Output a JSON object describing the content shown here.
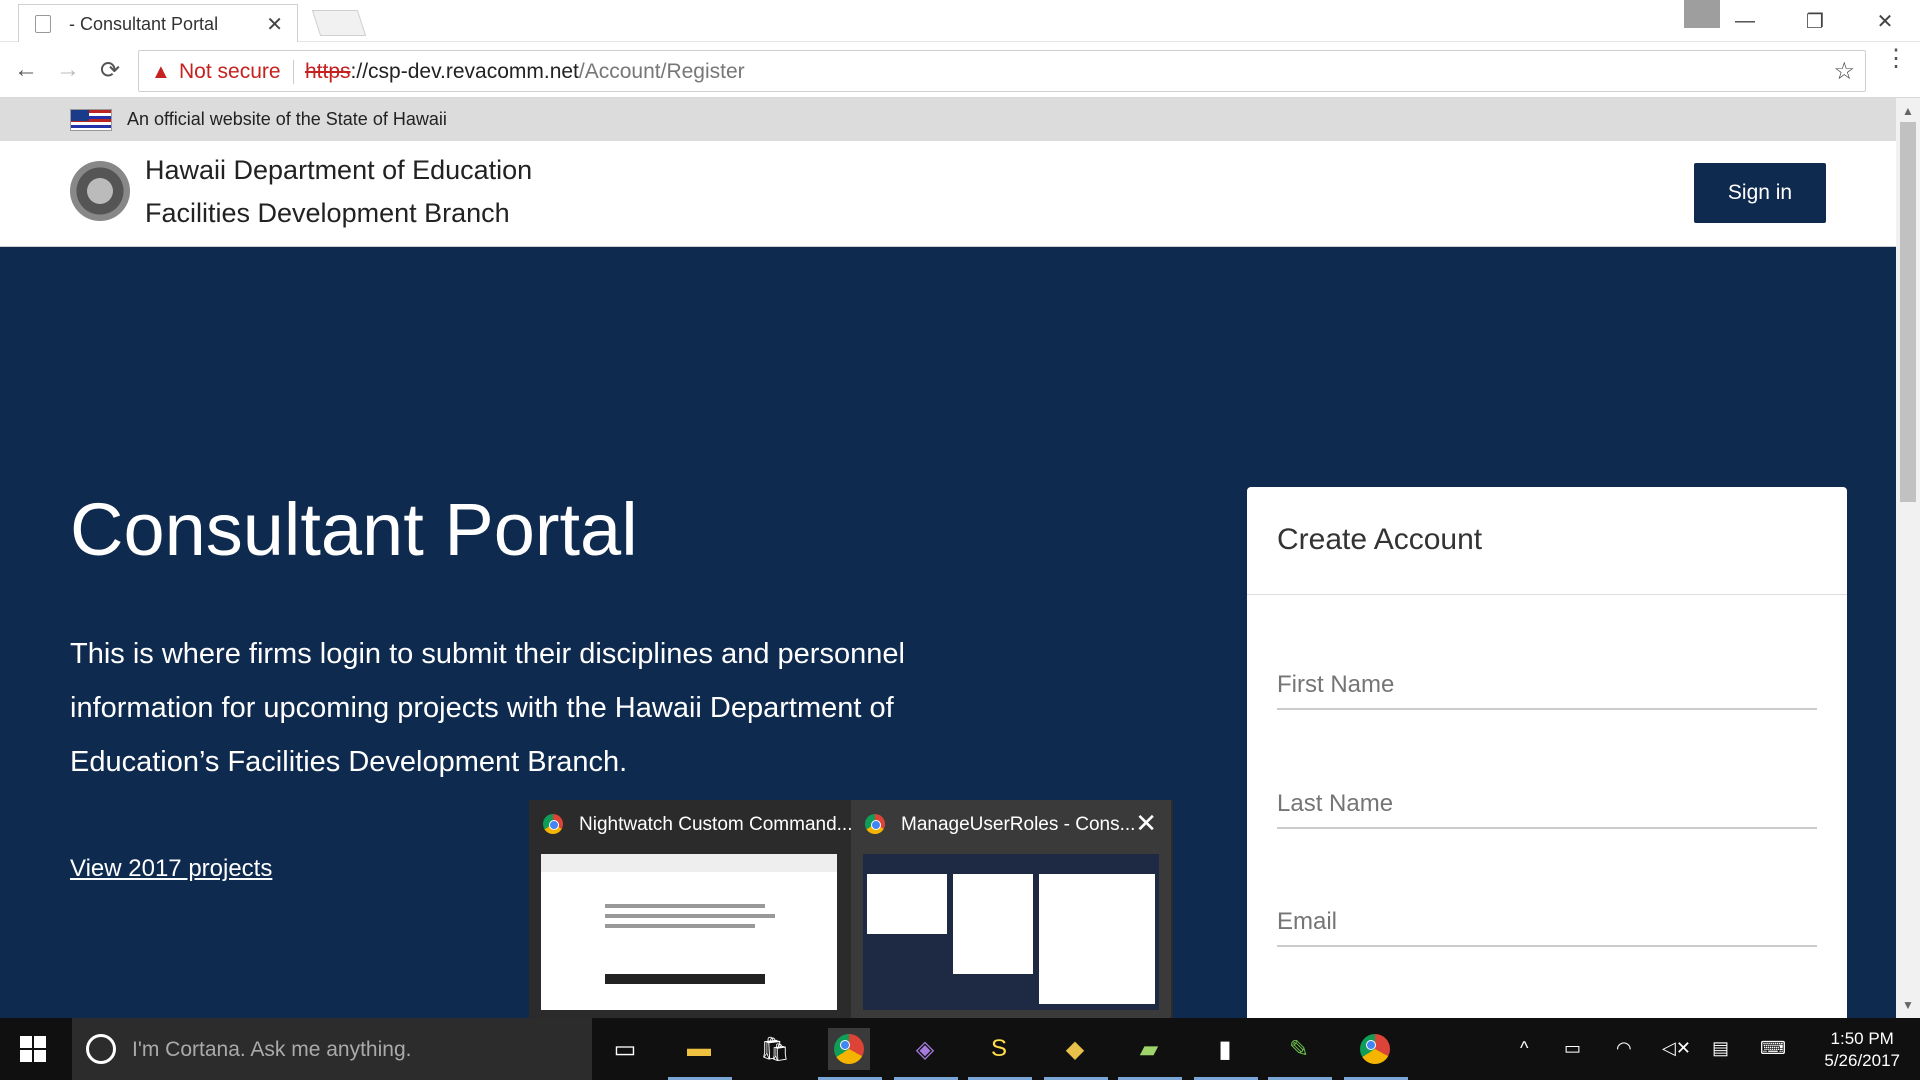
{
  "browser": {
    "tab_title": "- Consultant Portal",
    "security_label": "Not secure",
    "url_scheme": "https",
    "url_host": "://csp-dev.revacomm.net",
    "url_path": "/Account/Register"
  },
  "page": {
    "official_banner": "An official website of the State of Hawaii",
    "dept_line1": "Hawaii Department of Education",
    "dept_line2": "Facilities Development Branch",
    "signin_label": "Sign in",
    "hero_title": "Consultant Portal",
    "hero_description": "This is where firms login to submit their disciplines and personnel information for upcoming projects with the Hawaii Department of Education’s Facilities Development Branch.",
    "projects_link": "View 2017 projects",
    "card_title": "Create Account",
    "fields": {
      "first_name_placeholder": "First Name",
      "last_name_placeholder": "Last Name",
      "email_placeholder": "Email"
    }
  },
  "thumbnails": [
    {
      "title": "Nightwatch Custom Command..."
    },
    {
      "title": "ManageUserRoles - Cons..."
    }
  ],
  "taskbar": {
    "cortana_placeholder": "I'm Cortana. Ask me anything.",
    "time": "1:50 PM",
    "date": "5/26/2017"
  },
  "colors": {
    "navy": "#0f2a4f",
    "warning_red": "#c5221f"
  }
}
